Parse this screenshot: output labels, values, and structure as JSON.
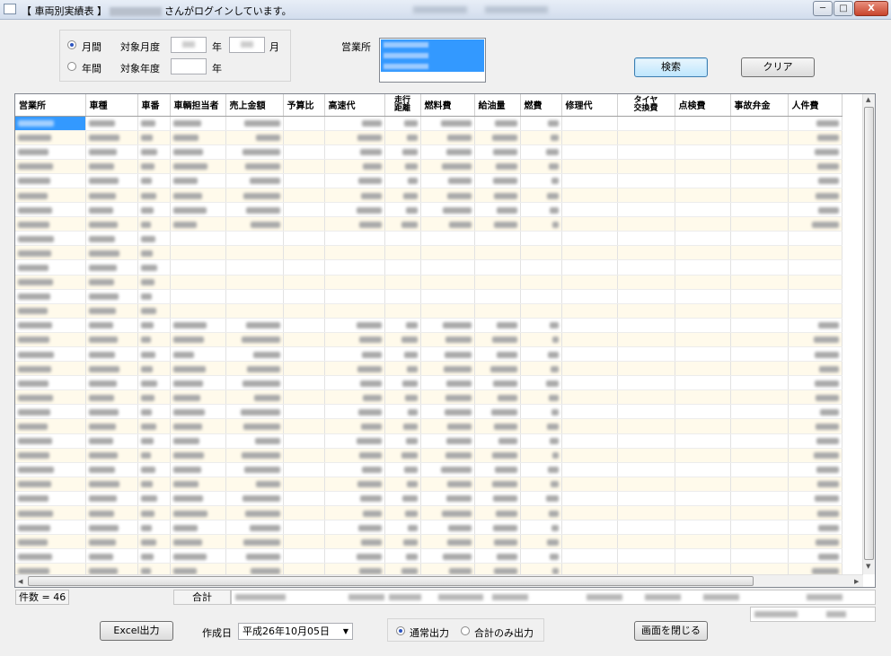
{
  "window": {
    "title_prefix": "【 車両別実績表 】",
    "title_suffix": "さんがログインしています。",
    "min_label": "─",
    "max_label": "□",
    "close_label": "X"
  },
  "filters": {
    "monthly_label": "月間",
    "yearly_label": "年間",
    "target_month_label": "対象月度",
    "target_year_label": "対象年度",
    "year_unit": "年",
    "month_unit": "月",
    "office_label": "営業所",
    "monthly_selected": true
  },
  "buttons": {
    "search": "検索",
    "clear": "クリア",
    "excel": "Excel出力",
    "close_screen": "画面を閉じる"
  },
  "grid": {
    "headers": [
      "営業所",
      "車種",
      "車番",
      "車輌担当者",
      "売上金額",
      "予算比",
      "高速代",
      "走行\n距離",
      "燃料費",
      "給油量",
      "燃費",
      "修理代",
      "タイヤ\n交換費",
      "点検費",
      "事故弁金",
      "人件費"
    ],
    "row_count_visible": 32
  },
  "footer": {
    "count_text": "件数 = 46",
    "total_label": "合計",
    "created_label": "作成日",
    "created_date": "平成26年10月05日",
    "normal_output_label": "通常出力",
    "total_only_label": "合計のみ出力",
    "normal_output_selected": true
  }
}
